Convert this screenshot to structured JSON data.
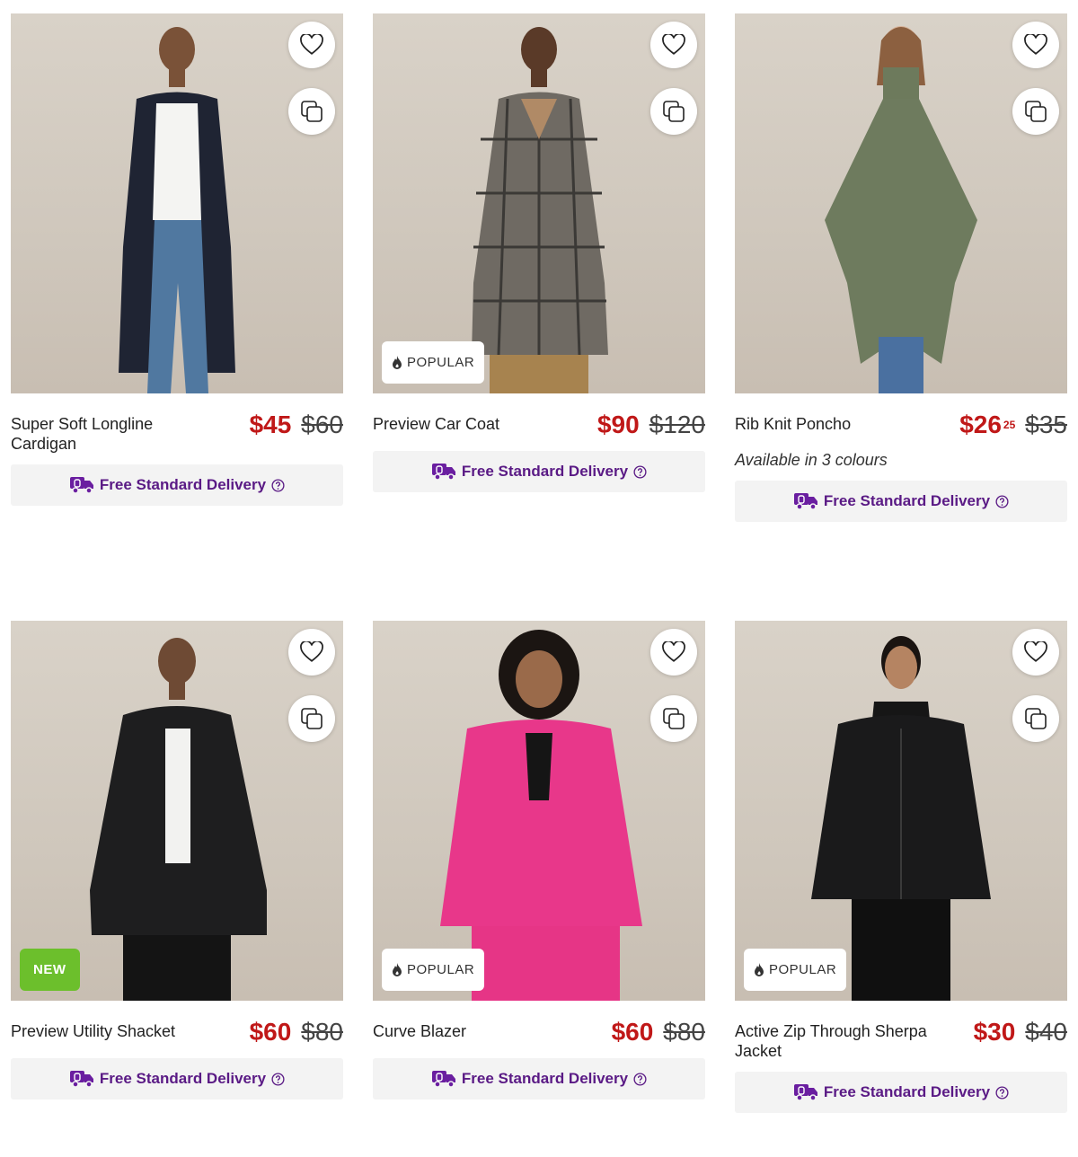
{
  "icons": {
    "wishlist": "heart-outline-icon",
    "compare": "compare-squares-icon",
    "popular": "flame-icon",
    "delivery": "delivery-truck-icon",
    "help": "question-circle-icon"
  },
  "colors": {
    "price": "#c01818",
    "delivery_text": "#5a1a85",
    "new_badge": "#6cbf2c",
    "delivery_bg": "#f3f3f3"
  },
  "products": [
    {
      "name": "Super Soft Longline Cardigan",
      "price": "$45",
      "price_cents": "",
      "was": "$60",
      "badge": "",
      "colours": "",
      "delivery": "Free Standard Delivery"
    },
    {
      "name": "Preview Car Coat",
      "price": "$90",
      "price_cents": "",
      "was": "$120",
      "badge": "POPULAR",
      "colours": "",
      "delivery": "Free Standard Delivery"
    },
    {
      "name": "Rib Knit Poncho",
      "price": "$26",
      "price_cents": "25",
      "was": "$35",
      "badge": "",
      "colours": "Available in 3 colours",
      "delivery": "Free Standard Delivery"
    },
    {
      "name": "Preview Utility Shacket",
      "price": "$60",
      "price_cents": "",
      "was": "$80",
      "badge": "NEW",
      "colours": "",
      "delivery": "Free Standard Delivery"
    },
    {
      "name": "Curve Blazer",
      "price": "$60",
      "price_cents": "",
      "was": "$80",
      "badge": "POPULAR",
      "colours": "",
      "delivery": "Free Standard Delivery"
    },
    {
      "name": "Active Zip Through Sherpa Jacket",
      "price": "$30",
      "price_cents": "",
      "was": "$40",
      "badge": "POPULAR",
      "colours": "",
      "delivery": "Free Standard Delivery"
    }
  ]
}
